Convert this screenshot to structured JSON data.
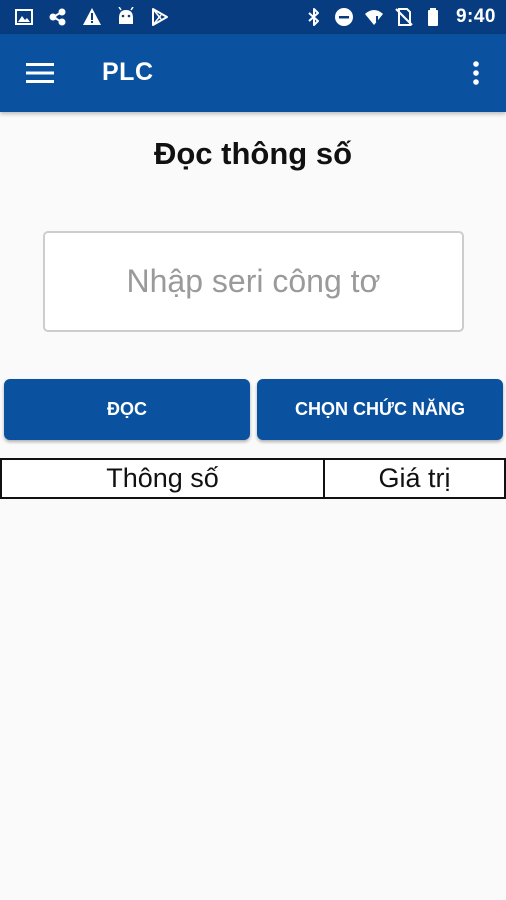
{
  "status_bar": {
    "time": "9:40",
    "left_icons": [
      "image-icon",
      "share-icon",
      "warning-icon",
      "android-icon",
      "play-store-icon"
    ],
    "right_icons": [
      "bluetooth-icon",
      "do-not-disturb-icon",
      "wifi-icon",
      "no-sim-icon",
      "battery-icon"
    ]
  },
  "app_bar": {
    "title": "PLC",
    "menu_icon": "hamburger-menu-icon",
    "more_icon": "more-vert-icon",
    "color": "#0a52a0"
  },
  "main": {
    "title": "Đọc thông số",
    "serial_input": {
      "value": "",
      "placeholder": "Nhập seri công tơ"
    },
    "read_button": "ĐỌC",
    "function_button": "CHỌN CHỨC NĂNG"
  },
  "table": {
    "headers": [
      "Thông số",
      "Giá trị"
    ],
    "rows": []
  },
  "colors": {
    "status_bar": "#073c80",
    "primary": "#0a52a0",
    "background": "#fafafa"
  }
}
